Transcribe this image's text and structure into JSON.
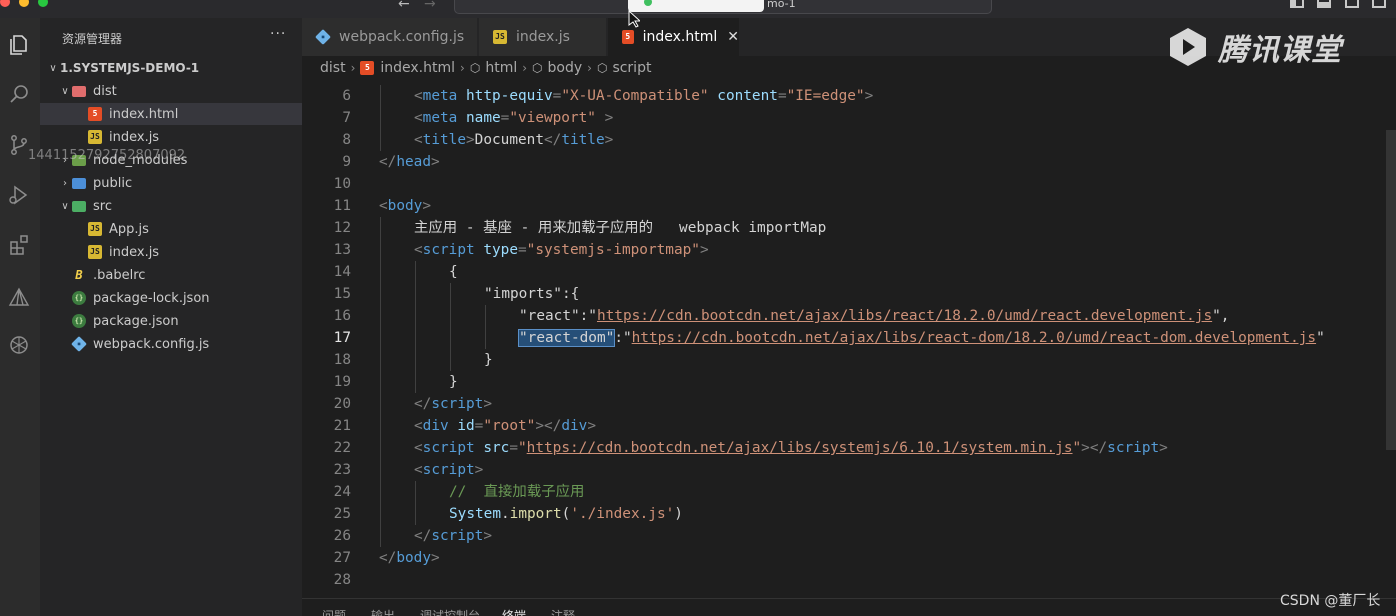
{
  "window": {
    "traffic_lights": [
      "#ff5f57",
      "#febc2e",
      "#28c840"
    ],
    "search_suffix": "mo-1"
  },
  "sidebar": {
    "title": "资源管理器",
    "more": "···",
    "watermark_number": "1441152792752807092",
    "tree": [
      {
        "label": "1.SYSTEMJS-DEMO-1",
        "kind": "root",
        "chevron": "∨"
      },
      {
        "label": "dist",
        "kind": "folder",
        "chevron": "∨",
        "icon": "folder-dist"
      },
      {
        "label": "index.html",
        "kind": "file",
        "icon": "html",
        "glyph": "5",
        "selected": true
      },
      {
        "label": "index.js",
        "kind": "file",
        "icon": "js",
        "glyph": "JS"
      },
      {
        "label": "node_modules",
        "kind": "folder",
        "chevron": "›",
        "icon": "folder-node"
      },
      {
        "label": "public",
        "kind": "folder",
        "chevron": "›",
        "icon": "folder-public"
      },
      {
        "label": "src",
        "kind": "folder",
        "chevron": "∨",
        "icon": "folder-src"
      },
      {
        "label": "App.js",
        "kind": "file",
        "icon": "js",
        "glyph": "JS"
      },
      {
        "label": "index.js",
        "kind": "file",
        "icon": "js",
        "glyph": "JS"
      },
      {
        "label": ".babelrc",
        "kind": "file",
        "icon": "babel",
        "glyph": "B"
      },
      {
        "label": "package-lock.json",
        "kind": "file",
        "icon": "json",
        "glyph": "{}"
      },
      {
        "label": "package.json",
        "kind": "file",
        "icon": "json",
        "glyph": "{}"
      },
      {
        "label": "webpack.config.js",
        "kind": "file",
        "icon": "webpack",
        "glyph": "◆"
      }
    ]
  },
  "tabs": [
    {
      "label": "webpack.config.js",
      "icon": "webpack",
      "glyph": "◆",
      "active": false
    },
    {
      "label": "index.js",
      "icon": "js",
      "glyph": "JS",
      "active": false
    },
    {
      "label": "index.html",
      "icon": "html",
      "glyph": "5",
      "active": true,
      "close": "✕"
    }
  ],
  "breadcrumb": [
    "dist",
    "index.html",
    "html",
    "body",
    "script"
  ],
  "editor": {
    "current_line": 17,
    "lines": [
      {
        "n": "6",
        "indent": 1,
        "tokens": [
          [
            "p",
            "<"
          ],
          [
            "tag",
            "meta"
          ],
          [
            "p",
            " "
          ],
          [
            "attr",
            "http-equiv"
          ],
          [
            "p",
            "="
          ],
          [
            "str",
            "\"X-UA-Compatible\""
          ],
          [
            "p",
            " "
          ],
          [
            "attr",
            "content"
          ],
          [
            "p",
            "="
          ],
          [
            "str",
            "\"IE=edge\""
          ],
          [
            "p",
            ">"
          ]
        ]
      },
      {
        "n": "7",
        "indent": 1,
        "tokens": [
          [
            "p",
            "<"
          ],
          [
            "tag",
            "meta"
          ],
          [
            "p",
            " "
          ],
          [
            "attr",
            "name"
          ],
          [
            "p",
            "="
          ],
          [
            "str",
            "\"viewport\""
          ],
          [
            "p",
            " >"
          ]
        ]
      },
      {
        "n": "8",
        "indent": 1,
        "tokens": [
          [
            "p",
            "<"
          ],
          [
            "tag",
            "title"
          ],
          [
            "p",
            ">"
          ],
          [
            "key",
            "Document"
          ],
          [
            "p",
            "</"
          ],
          [
            "tag",
            "title"
          ],
          [
            "p",
            ">"
          ]
        ]
      },
      {
        "n": "9",
        "indent": 0,
        "tokens": [
          [
            "p",
            "</"
          ],
          [
            "tag",
            "head"
          ],
          [
            "p",
            ">"
          ]
        ]
      },
      {
        "n": "10",
        "indent": 0,
        "tokens": []
      },
      {
        "n": "11",
        "indent": 0,
        "tokens": [
          [
            "p",
            "<"
          ],
          [
            "tag",
            "body"
          ],
          [
            "p",
            ">"
          ]
        ]
      },
      {
        "n": "12",
        "indent": 1,
        "tokens": [
          [
            "key",
            "主应用 - 基座 - 用来加载子应用的   webpack importMap"
          ]
        ]
      },
      {
        "n": "13",
        "indent": 1,
        "tokens": [
          [
            "p",
            "<"
          ],
          [
            "tag",
            "script"
          ],
          [
            "p",
            " "
          ],
          [
            "attr",
            "type"
          ],
          [
            "p",
            "="
          ],
          [
            "str",
            "\"systemjs-importmap\""
          ],
          [
            "p",
            ">"
          ]
        ]
      },
      {
        "n": "14",
        "indent": 2,
        "tokens": [
          [
            "key",
            "{"
          ]
        ]
      },
      {
        "n": "15",
        "indent": 3,
        "tokens": [
          [
            "key",
            "\"imports\":{"
          ]
        ]
      },
      {
        "n": "16",
        "indent": 4,
        "tokens": [
          [
            "key",
            "\"react\":\""
          ],
          [
            "url",
            "https://cdn.bootcdn.net/ajax/libs/react/18.2.0/umd/react.development.js"
          ],
          [
            "key",
            "\","
          ]
        ]
      },
      {
        "n": "17",
        "indent": 4,
        "tokens": [
          [
            "sel",
            "\"react-dom\""
          ],
          [
            "key",
            ":\""
          ],
          [
            "url",
            "https://cdn.bootcdn.net/ajax/libs/react-dom/18.2.0/umd/react-dom.development.js"
          ],
          [
            "key",
            "\""
          ]
        ]
      },
      {
        "n": "18",
        "indent": 3,
        "tokens": [
          [
            "key",
            "}"
          ]
        ]
      },
      {
        "n": "19",
        "indent": 2,
        "tokens": [
          [
            "key",
            "}"
          ]
        ]
      },
      {
        "n": "20",
        "indent": 1,
        "tokens": [
          [
            "p",
            "</"
          ],
          [
            "tag",
            "script"
          ],
          [
            "p",
            ">"
          ]
        ]
      },
      {
        "n": "21",
        "indent": 1,
        "tokens": [
          [
            "p",
            "<"
          ],
          [
            "tag",
            "div"
          ],
          [
            "p",
            " "
          ],
          [
            "attr",
            "id"
          ],
          [
            "p",
            "="
          ],
          [
            "str",
            "\"root\""
          ],
          [
            "p",
            "></"
          ],
          [
            "tag",
            "div"
          ],
          [
            "p",
            ">"
          ]
        ]
      },
      {
        "n": "22",
        "indent": 1,
        "tokens": [
          [
            "p",
            "<"
          ],
          [
            "tag",
            "script"
          ],
          [
            "p",
            " "
          ],
          [
            "attr",
            "src"
          ],
          [
            "p",
            "="
          ],
          [
            "str",
            "\""
          ],
          [
            "url",
            "https://cdn.bootcdn.net/ajax/libs/systemjs/6.10.1/system.min.js"
          ],
          [
            "str",
            "\""
          ],
          [
            "p",
            "></"
          ],
          [
            "tag",
            "script"
          ],
          [
            "p",
            ">"
          ]
        ]
      },
      {
        "n": "23",
        "indent": 1,
        "tokens": [
          [
            "p",
            "<"
          ],
          [
            "tag",
            "script"
          ],
          [
            "p",
            ">"
          ]
        ]
      },
      {
        "n": "24",
        "indent": 2,
        "tokens": [
          [
            "com",
            "//  直接加载子应用"
          ]
        ]
      },
      {
        "n": "25",
        "indent": 2,
        "tokens": [
          [
            "attr",
            "System"
          ],
          [
            "key",
            "."
          ],
          [
            "fn",
            "import"
          ],
          [
            "key",
            "("
          ],
          [
            "str",
            "'./index.js'"
          ],
          [
            "key",
            ")"
          ]
        ]
      },
      {
        "n": "26",
        "indent": 1,
        "tokens": [
          [
            "p",
            "</"
          ],
          [
            "tag",
            "script"
          ],
          [
            "p",
            ">"
          ]
        ]
      },
      {
        "n": "27",
        "indent": 0,
        "tokens": [
          [
            "p",
            "</"
          ],
          [
            "tag",
            "body"
          ],
          [
            "p",
            ">"
          ]
        ]
      },
      {
        "n": "28",
        "indent": 0,
        "tokens": []
      }
    ]
  },
  "panel": {
    "tabs": [
      "问题",
      "输出",
      "调试控制台",
      "终端",
      "注释"
    ],
    "active": "终端"
  },
  "overlay": {
    "brand_text": "腾讯课堂",
    "csdn_credit": "CSDN @董厂长"
  },
  "colors": {
    "accent_selection": "#264f78",
    "html_icon": "#e44d26",
    "js_icon": "#d7b833"
  }
}
